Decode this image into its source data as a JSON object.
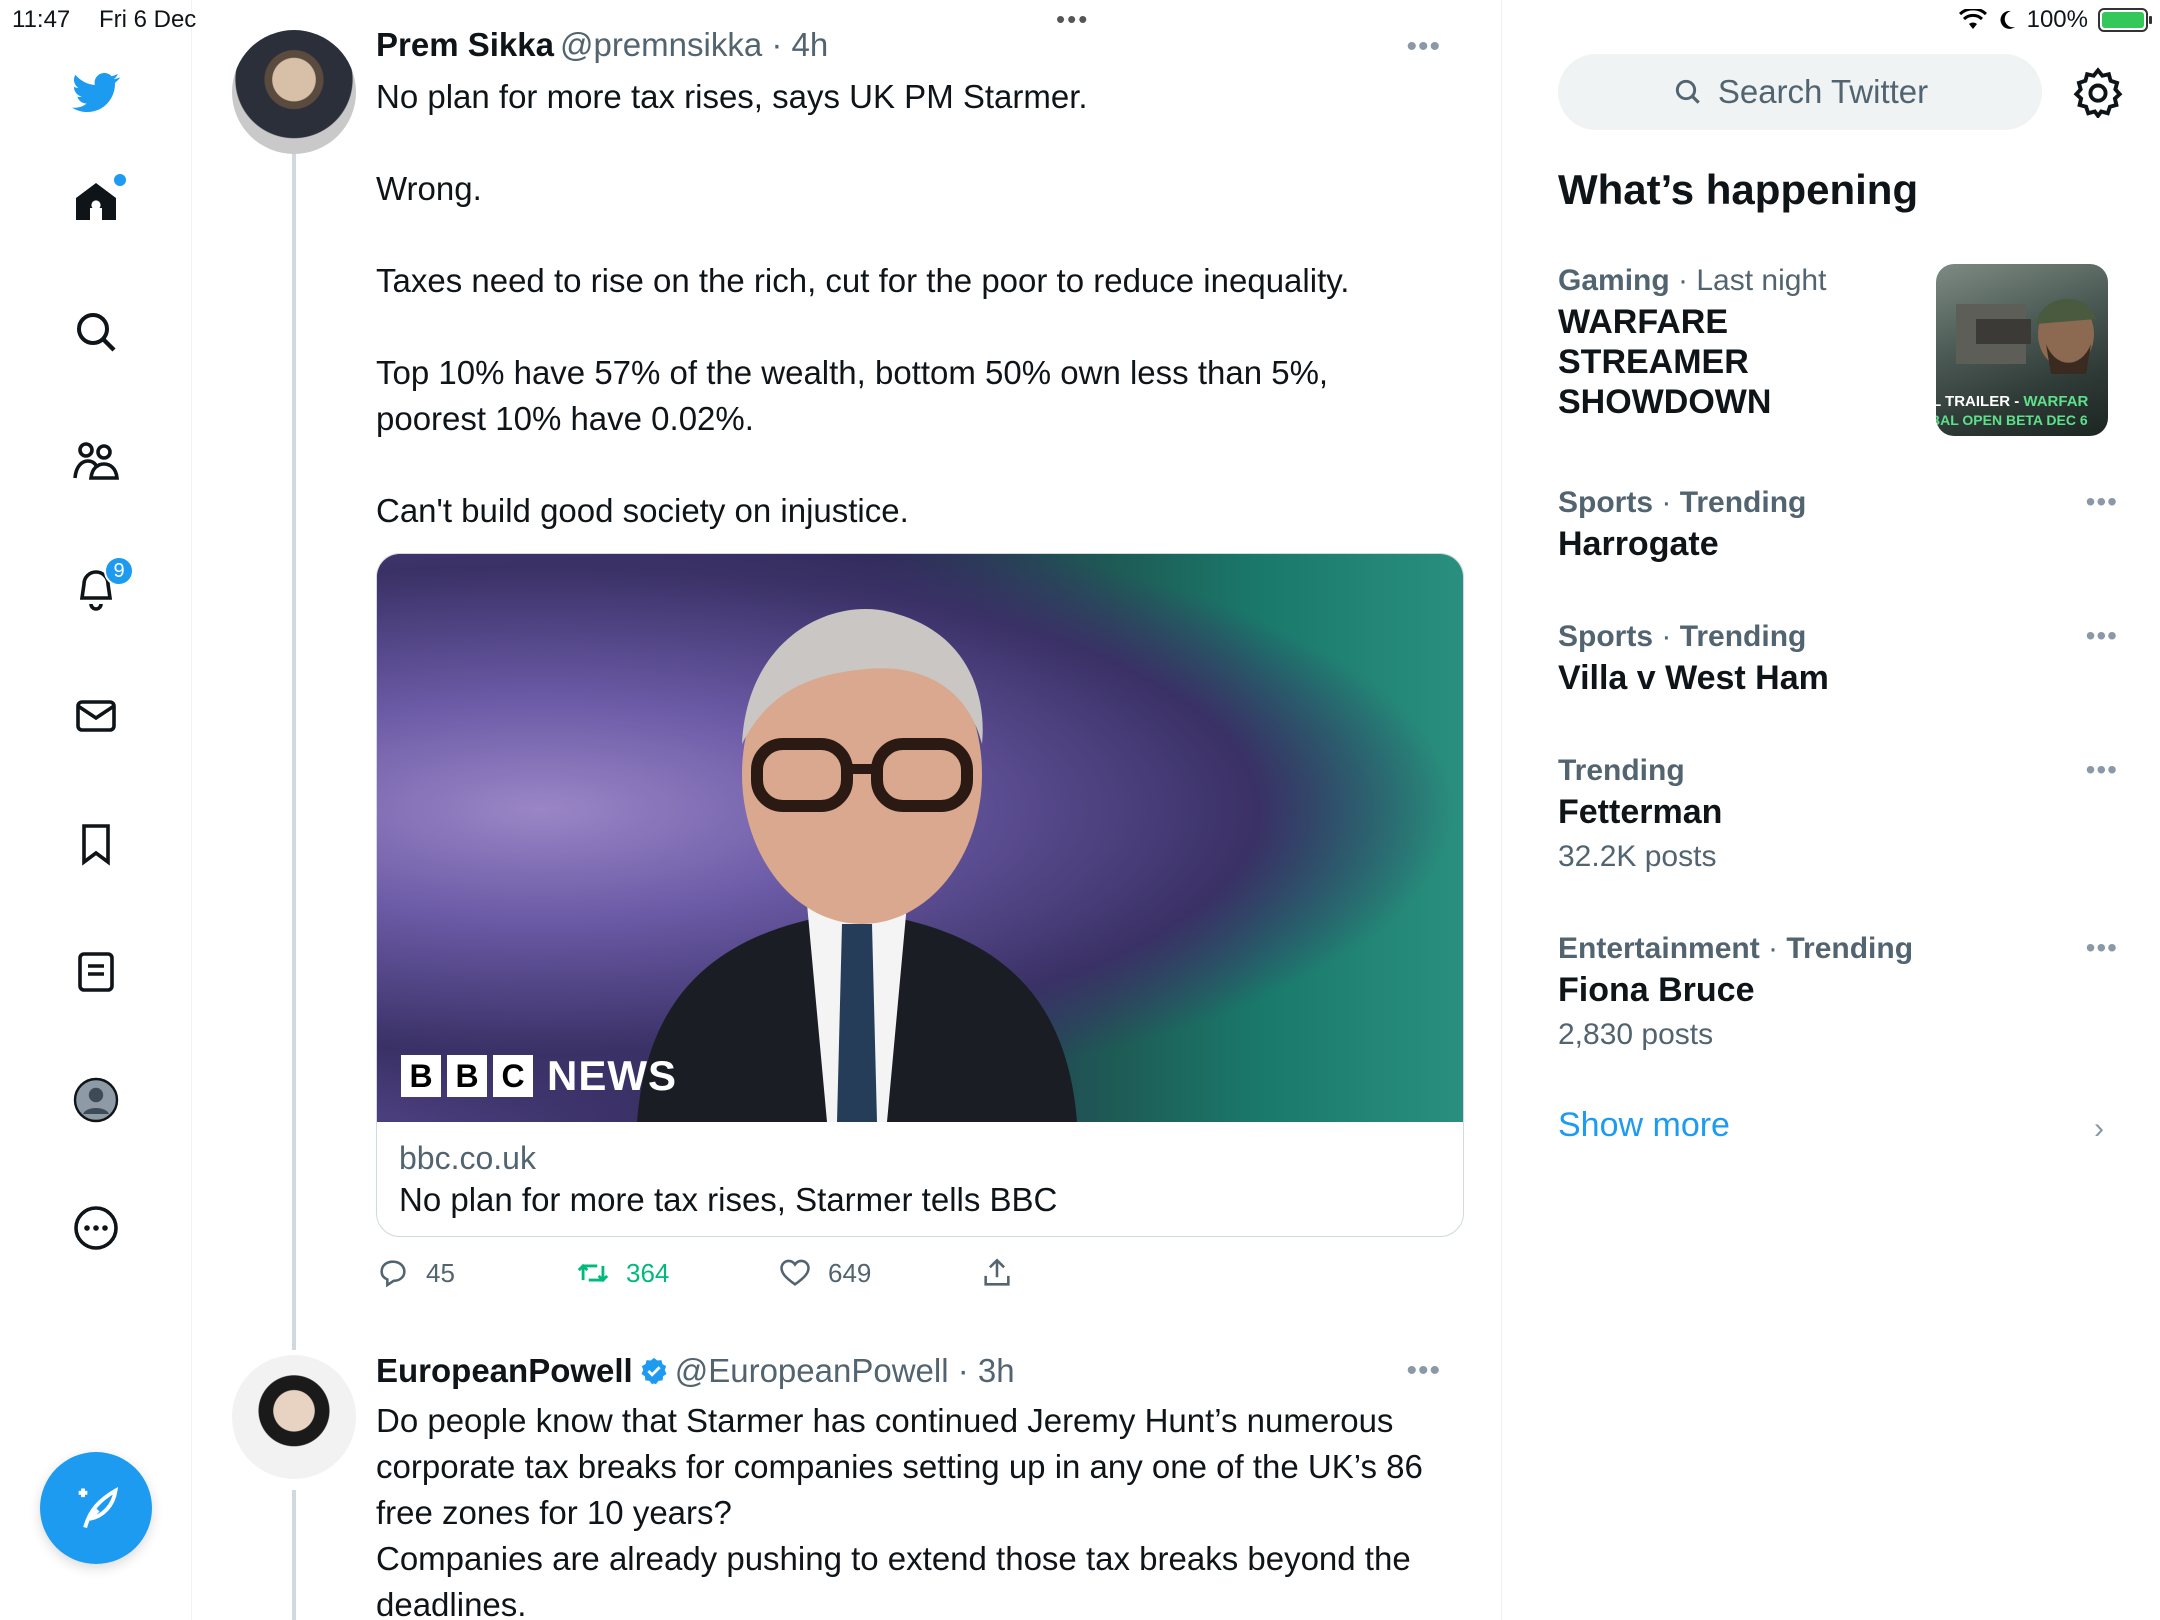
{
  "status_bar": {
    "time": "11:47",
    "date": "Fri 6 Dec",
    "battery": "100%"
  },
  "nav": {
    "notifications_badge": "9"
  },
  "tweets": [
    {
      "name": "Prem Sikka",
      "handle": "@premnsikka",
      "time": "4h",
      "lines": [
        "No plan for more tax rises, says UK PM Starmer.",
        "Wrong.",
        "Taxes need to rise on the rich, cut for the poor to reduce inequality.",
        "Top 10% have 57% of the wealth, bottom 50% own less than 5%,\npoorest 10% have 0.02%.",
        "Can't build good society on injustice."
      ],
      "card": {
        "brand_letters": [
          "B",
          "B",
          "C"
        ],
        "brand_word": "NEWS",
        "domain": "bbc.co.uk",
        "title": "No plan for more tax rises, Starmer tells BBC"
      },
      "replies": "45",
      "retweets": "364",
      "likes": "649"
    },
    {
      "name": "EuropeanPowell",
      "handle": "@EuropeanPowell",
      "time": "3h",
      "body": "Do people know that Starmer has continued Jeremy Hunt’s numerous corporate tax breaks for companies setting up in any one of the UK’s 86 free zones for 10 years?\nCompanies are already pushing to extend those tax breaks beyond the deadlines."
    }
  ],
  "search": {
    "placeholder": "Search Twitter"
  },
  "whats_happening": {
    "title": "What’s happening",
    "trends": [
      {
        "category": "Gaming",
        "context": "Last night",
        "title": "WARFARE STREAMER SHOWDOWN",
        "image_text_1": "L TRAILER - ",
        "image_text_1b": "WARFAR",
        "image_text_2": "BAL OPEN BETA DEC 6"
      },
      {
        "category": "Sports",
        "context": "Trending",
        "title": "Harrogate"
      },
      {
        "category": "Sports",
        "context": "Trending",
        "title": "Villa v West Ham"
      },
      {
        "category": "Trending",
        "title": "Fetterman",
        "posts": "32.2K posts"
      },
      {
        "category": "Entertainment",
        "context": "Trending",
        "title": "Fiona Bruce",
        "posts": "2,830 posts"
      }
    ],
    "show_more": "Show more"
  },
  "colors": {
    "accent": "#1d9bf0",
    "retweet": "#00ba7c",
    "secondary_text": "#536471"
  }
}
